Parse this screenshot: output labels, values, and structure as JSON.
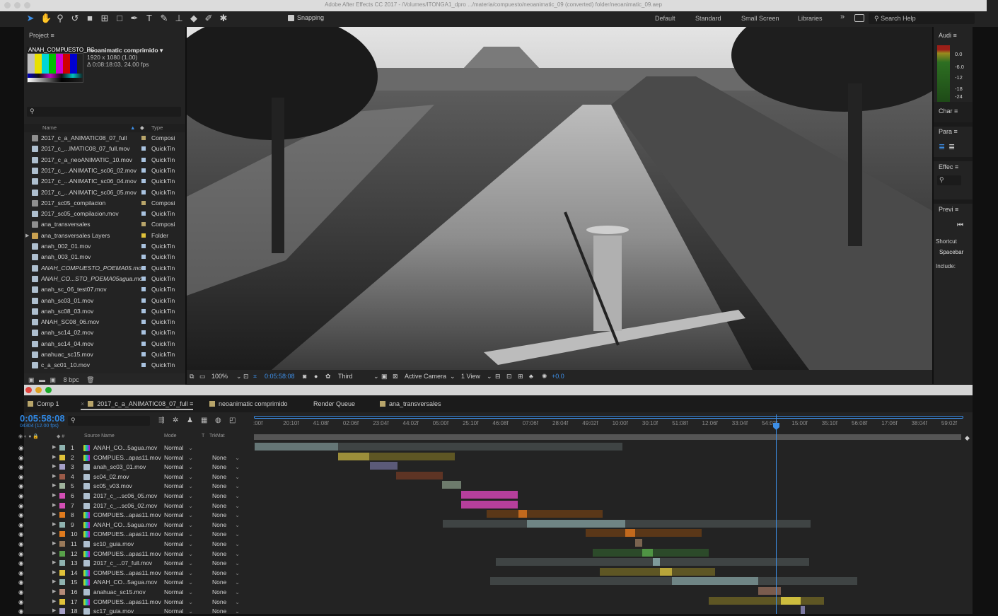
{
  "window": {
    "title": "Adobe After Effects CC 2017 - /Volumes/ITONGA1_dpro .../materia/compuesto/neoanimatic_09 (converted) folder/neoanimatic_09.aep"
  },
  "toolbar": {
    "snapping": "Snapping",
    "workspaces": [
      "Default",
      "Standard",
      "Small Screen",
      "Libraries"
    ],
    "more": "»",
    "search_placeholder": "Search Help"
  },
  "project": {
    "title": "Project ≡",
    "comp_name": "ANAH_COMPUESTO_PC",
    "sel_name": "neoanimatic comprimido ▾",
    "sel_res": "1920 x 1080 (1.00)",
    "sel_dur": "Δ 0:08:18:03, 24.00 fps",
    "col_name": "Name",
    "col_type": "Type",
    "items": [
      {
        "name": "2017_c_a_ANIMATIC08_07_full",
        "type": "Composi",
        "kind": "cmp",
        "color": "#b8a56a"
      },
      {
        "name": "2017_c_...IMATIC08_07_full.mov",
        "type": "QuickTin",
        "kind": "mov",
        "color": "#a9c3e0"
      },
      {
        "name": "2017_c_a_neoANIMATIC_10.mov",
        "type": "QuickTin",
        "kind": "mov",
        "color": "#a9c3e0"
      },
      {
        "name": "2017_c_...ANIMATIC_sc06_02.mov",
        "type": "QuickTin",
        "kind": "mov",
        "color": "#a9c3e0"
      },
      {
        "name": "2017_c_...ANIMATIC_sc06_04.mov",
        "type": "QuickTin",
        "kind": "mov",
        "color": "#a9c3e0"
      },
      {
        "name": "2017_c_...ANIMATIC_sc06_05.mov",
        "type": "QuickTin",
        "kind": "mov",
        "color": "#a9c3e0"
      },
      {
        "name": "2017_sc05_compilacion",
        "type": "Composi",
        "kind": "cmp",
        "color": "#b8a56a"
      },
      {
        "name": "2017_sc05_compilacion.mov",
        "type": "QuickTin",
        "kind": "mov",
        "color": "#a9c3e0"
      },
      {
        "name": "ana_transversales",
        "type": "Composi",
        "kind": "cmp",
        "color": "#b8a56a"
      },
      {
        "name": "ana_transversales Layers",
        "type": "Folder",
        "kind": "fld",
        "color": "#e0c23a"
      },
      {
        "name": "anah_002_01.mov",
        "type": "QuickTin",
        "kind": "mov",
        "color": "#a9c3e0"
      },
      {
        "name": "anah_003_01.mov",
        "type": "QuickTin",
        "kind": "mov",
        "color": "#a9c3e0"
      },
      {
        "name": "ANAH_COMPUESTO_POEMA05.mov",
        "type": "QuickTin",
        "kind": "mov",
        "color": "#a9c3e0"
      },
      {
        "name": "ANAH_CO...STO_POEMA05agua.mov",
        "type": "QuickTin",
        "kind": "mov",
        "color": "#a9c3e0"
      },
      {
        "name": "anah_sc_06_test07.mov",
        "type": "QuickTin",
        "kind": "mov",
        "color": "#a9c3e0"
      },
      {
        "name": "anah_sc03_01.mov",
        "type": "QuickTin",
        "kind": "mov",
        "color": "#a9c3e0"
      },
      {
        "name": "anah_sc08_03.mov",
        "type": "QuickTin",
        "kind": "mov",
        "color": "#a9c3e0"
      },
      {
        "name": "ANAH_SC08_06.mov",
        "type": "QuickTin",
        "kind": "mov",
        "color": "#a9c3e0"
      },
      {
        "name": "anah_sc14_02.mov",
        "type": "QuickTin",
        "kind": "mov",
        "color": "#a9c3e0"
      },
      {
        "name": "anah_sc14_04.mov",
        "type": "QuickTin",
        "kind": "mov",
        "color": "#a9c3e0"
      },
      {
        "name": "anahuac_sc15.mov",
        "type": "QuickTin",
        "kind": "mov",
        "color": "#a9c3e0"
      },
      {
        "name": "c_a_sc01_10.mov",
        "type": "QuickTin",
        "kind": "mov",
        "color": "#a9c3e0"
      }
    ],
    "bpc": "8 bpc"
  },
  "viewer": {
    "zoom": "100%",
    "timecode": "0:05:58:08",
    "resolution": "Third",
    "camera": "Active Camera",
    "views": "1 View",
    "exposure": "+0.0"
  },
  "panels": {
    "audio": "Audi ≡",
    "audio_levels": [
      "0.0",
      "-6.0",
      "-12",
      "-18",
      "-24"
    ],
    "char": "Char ≡",
    "para": "Para ≡",
    "effects": "Effec ≡",
    "preview": "Previ ≡",
    "shortcut": "Shortcut",
    "spacebar": "Spacebar",
    "include": "Include:"
  },
  "timeline": {
    "tabs": [
      {
        "label": "Comp 1",
        "color": "#b8a56a"
      },
      {
        "label": "2017_c_a_ANIMATIC08_07_full ≡",
        "color": "#b8a56a"
      },
      {
        "label": "neoanimatic comprimido",
        "color": "#b8a56a"
      },
      {
        "label": "Render Queue",
        "color": ""
      },
      {
        "label": "ana_transversales",
        "color": "#b8a56a"
      }
    ],
    "timecode": "0:05:58:08",
    "timecode_sub": "04304 (12.00 fps)",
    "col_source": "Source Name",
    "col_mode": "Mode",
    "col_t": "T",
    "col_trkmat": "TrkMat",
    "ruler": [
      ":00f",
      "20:10f",
      "41:08f",
      "02:06f",
      "23:04f",
      "44:02f",
      "05:00f",
      "25:10f",
      "46:08f",
      "07:06f",
      "28:04f",
      "49:02f",
      "10:00f",
      "30:10f",
      "51:08f",
      "12:06f",
      "33:04f",
      "54:02f",
      "15:00f",
      "35:10f",
      "56:08f",
      "17:06f",
      "38:04f",
      "59:02f"
    ],
    "layers": [
      {
        "n": "1",
        "name": "ANAH_CO...5agua.mov",
        "mode": "Normal",
        "trk": "",
        "lab": "#8fb3b0",
        "comp": true
      },
      {
        "n": "2",
        "name": "COMPUES...apas11.mov",
        "mode": "Normal",
        "trk": "None",
        "lab": "#e0c23a",
        "comp": true
      },
      {
        "n": "3",
        "name": "anah_sc03_01.mov",
        "mode": "Normal",
        "trk": "None",
        "lab": "#a6a0c8",
        "comp": false
      },
      {
        "n": "4",
        "name": "sc04_02.mov",
        "mode": "Normal",
        "trk": "None",
        "lab": "#9a5a48",
        "comp": false
      },
      {
        "n": "5",
        "name": "sc05_v03.mov",
        "mode": "Normal",
        "trk": "None",
        "lab": "#9fb39c",
        "comp": false
      },
      {
        "n": "6",
        "name": "2017_c_...sc06_05.mov",
        "mode": "Normal",
        "trk": "None",
        "lab": "#d34fb5",
        "comp": false
      },
      {
        "n": "7",
        "name": "2017_c_...sc06_02.mov",
        "mode": "Normal",
        "trk": "None",
        "lab": "#d34fb5",
        "comp": false
      },
      {
        "n": "8",
        "name": "COMPUES...apas11.mov",
        "mode": "Normal",
        "trk": "None",
        "lab": "#e07b1e",
        "comp": true
      },
      {
        "n": "9",
        "name": "ANAH_CO...5agua.mov",
        "mode": "Normal",
        "trk": "None",
        "lab": "#8fb3b0",
        "comp": true
      },
      {
        "n": "10",
        "name": "COMPUES...apas11.mov",
        "mode": "Normal",
        "trk": "None",
        "lab": "#e07b1e",
        "comp": true
      },
      {
        "n": "11",
        "name": "sc10_guia.mov",
        "mode": "Normal",
        "trk": "None",
        "lab": "#9a7a5a",
        "comp": false
      },
      {
        "n": "12",
        "name": "COMPUES...apas11.mov",
        "mode": "Normal",
        "trk": "None",
        "lab": "#58a24a",
        "comp": true
      },
      {
        "n": "13",
        "name": "2017_c_...07_full.mov",
        "mode": "Normal",
        "trk": "None",
        "lab": "#8fb3b0",
        "comp": false
      },
      {
        "n": "14",
        "name": "COMPUES...apas11.mov",
        "mode": "Normal",
        "trk": "None",
        "lab": "#e0c23a",
        "comp": true
      },
      {
        "n": "15",
        "name": "ANAH_CO...5agua.mov",
        "mode": "Normal",
        "trk": "None",
        "lab": "#8fb3b0",
        "comp": true
      },
      {
        "n": "16",
        "name": "anahuac_sc15.mov",
        "mode": "Normal",
        "trk": "None",
        "lab": "#b58a78",
        "comp": false
      },
      {
        "n": "17",
        "name": "COMPUES...apas11.mov",
        "mode": "Normal",
        "trk": "None",
        "lab": "#e0c23a",
        "comp": true
      },
      {
        "n": "18",
        "name": "sc17_guia.mov",
        "mode": "Normal",
        "trk": "None",
        "lab": "#a6a0c8",
        "comp": false
      }
    ]
  }
}
